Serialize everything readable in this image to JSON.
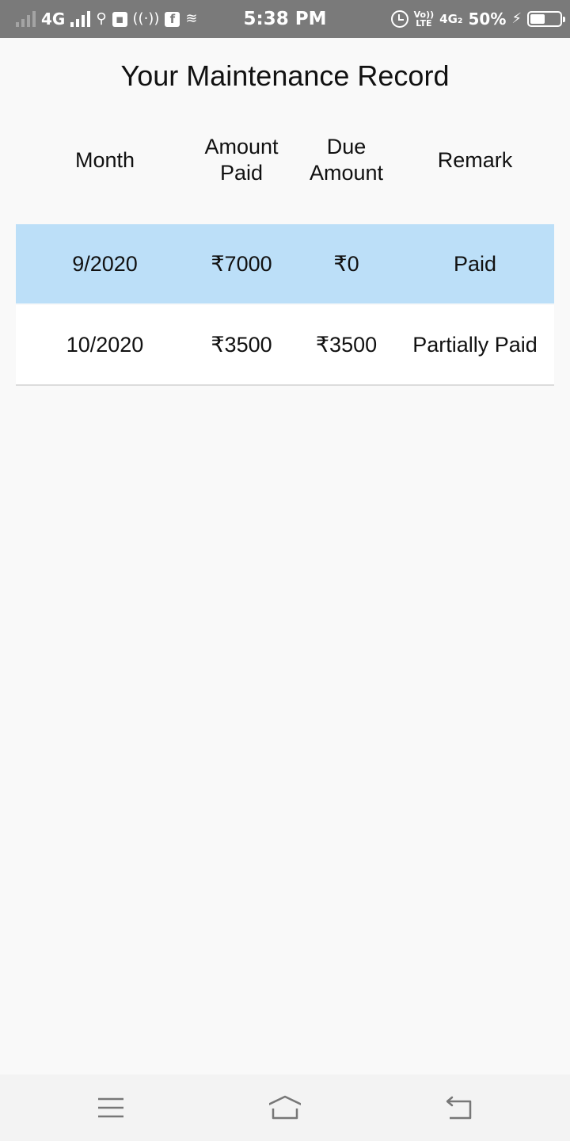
{
  "status_bar": {
    "time": "5:38 PM",
    "network_left": "4G",
    "facebook_glyph": "f",
    "usb_glyph": "⚲",
    "volte": "Vo))",
    "lte": "LTE",
    "network_right": "4G₂",
    "battery_percent": "50%",
    "battery_level": 0.5,
    "charging_glyph": "⚡",
    "icons": [
      "signal-dim-icon",
      "signal-icon",
      "usb-icon",
      "notification-icon",
      "hotspot-icon",
      "facebook-icon",
      "data-saver-icon",
      "alarm-icon",
      "volte-icon",
      "battery-icon",
      "charging-icon"
    ]
  },
  "page": {
    "title": "Your Maintenance Record"
  },
  "table": {
    "headers": {
      "month": "Month",
      "amount_paid_line1": "Amount",
      "amount_paid_line2": "Paid",
      "due_amount_line1": "Due",
      "due_amount_line2": "Amount",
      "remark": "Remark"
    },
    "rows": [
      {
        "month": "9/2020",
        "amount_paid": "₹7000",
        "due_amount": "₹0",
        "remark": "Paid"
      },
      {
        "month": "10/2020",
        "amount_paid": "₹3500",
        "due_amount": "₹3500",
        "remark": "Partially Paid"
      }
    ],
    "highlight_color": "#bcdff8"
  },
  "nav_bar": {
    "icons": [
      "menu-icon",
      "home-icon",
      "back-icon"
    ]
  }
}
